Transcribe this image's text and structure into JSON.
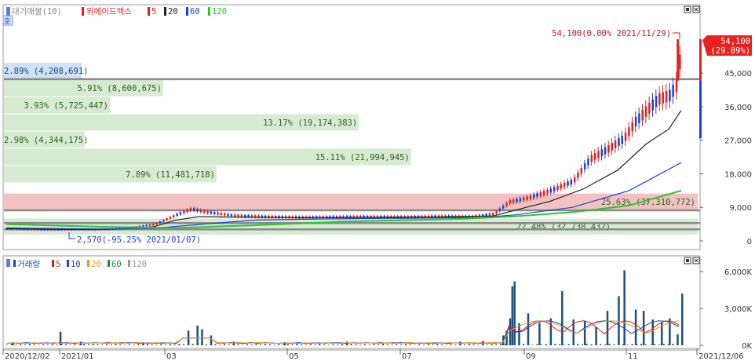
{
  "price_legend": {
    "dots_label": "대기매물(10)",
    "name": "위메이드맥스",
    "ma": [
      {
        "period": "5",
        "color": "#e02020"
      },
      {
        "period": "20",
        "color": "#222222"
      },
      {
        "period": "60",
        "color": "#1f3fd8"
      },
      {
        "period": "120",
        "color": "#2ec52e"
      }
    ]
  },
  "side_button": "호",
  "volume_legend": {
    "name": "거래량",
    "ma": [
      {
        "period": "5",
        "color": "#e02020"
      },
      {
        "period": "10",
        "color": "#1f3fd8"
      },
      {
        "period": "20",
        "color": "#e89a20"
      },
      {
        "period": "60",
        "color": "#1a8a4a"
      },
      {
        "period": "120",
        "color": "#999999"
      }
    ]
  },
  "chart_data": [
    {
      "type": "candlestick",
      "title": "위메이드맥스",
      "ylim": [
        0,
        54100
      ],
      "y_ticks": [
        "45,000",
        "36,000",
        "27,000",
        "18,000",
        "9,000",
        "0"
      ],
      "y_tick_values": [
        45000,
        36000,
        27000,
        18000,
        9000,
        0
      ],
      "x_tick_labels": [
        "2020/12/02",
        "2021/01",
        "03",
        "05",
        "07",
        "09",
        "11",
        "2021/12/06"
      ],
      "last_price": {
        "value": 54100,
        "label": "54,100",
        "change": "(29.89%)"
      },
      "high_annotation": {
        "text": "54,100(0.00% 2021/11/29)",
        "value": 54100,
        "date": "2021/11/29"
      },
      "low_annotation": {
        "text": "2,570(-95.25% 2021/01/07)",
        "value": 2570,
        "date": "2021/01/07"
      },
      "supply_bars": [
        {
          "label": "2.89% (4,208,691)",
          "price_from": 47800,
          "price_to": 43500,
          "pct": 2.89
        },
        {
          "label": "5.91% (8,600,675)",
          "price_from": 43200,
          "price_to": 38800,
          "pct": 5.91
        },
        {
          "label": "3.93% (5,725,447)",
          "price_from": 38600,
          "price_to": 34200,
          "pct": 3.93
        },
        {
          "label": "13.17% (19,174,383)",
          "price_from": 34000,
          "price_to": 29600,
          "pct": 13.17
        },
        {
          "label": "2.98% (4,344,175)",
          "price_from": 29400,
          "price_to": 25000,
          "pct": 2.98
        },
        {
          "label": "15.11% (21,994,945)",
          "price_from": 24800,
          "price_to": 20300,
          "pct": 15.11
        },
        {
          "label": "7.89% (11,481,718)",
          "price_from": 20100,
          "price_to": 15700,
          "pct": 7.89
        },
        {
          "label": "25.63% (37,310,772)",
          "price_from": 12700,
          "price_to": 8300,
          "pct": 25.63,
          "highlight": true
        },
        {
          "label": "22.48% (32,730,432)",
          "price_from": 6000,
          "price_to": 1700,
          "pct": 22.48
        }
      ],
      "series": [
        {
          "name": "5",
          "values": [
            [
              0,
              3200
            ],
            [
              20,
              3000
            ],
            [
              40,
              2900
            ],
            [
              60,
              3000
            ],
            [
              90,
              3100
            ],
            [
              110,
              3600
            ],
            [
              130,
              4400
            ],
            [
              150,
              7000
            ],
            [
              163,
              8600
            ],
            [
              175,
              7800
            ],
            [
              200,
              6800
            ],
            [
              230,
              6500
            ],
            [
              260,
              6300
            ],
            [
              290,
              6400
            ],
            [
              320,
              6500
            ],
            [
              350,
              6400
            ],
            [
              380,
              6600
            ],
            [
              410,
              6500
            ],
            [
              430,
              7200
            ],
            [
              444,
              10500
            ],
            [
              460,
              11500
            ],
            [
              480,
              13500
            ],
            [
              500,
              16000
            ],
            [
              515,
              22000
            ],
            [
              530,
              24500
            ],
            [
              545,
              27500
            ],
            [
              555,
              32000
            ],
            [
              565,
              35000
            ],
            [
              575,
              38000
            ],
            [
              585,
              39000
            ],
            [
              592,
              42000
            ],
            [
              596,
              54100
            ]
          ]
        },
        {
          "name": "20",
          "values": [
            [
              0,
              3300
            ],
            [
              40,
              3100
            ],
            [
              80,
              3000
            ],
            [
              110,
              3300
            ],
            [
              130,
              3800
            ],
            [
              150,
              5600
            ],
            [
              170,
              6500
            ],
            [
              200,
              6400
            ],
            [
              260,
              6200
            ],
            [
              320,
              6300
            ],
            [
              380,
              6400
            ],
            [
              430,
              6700
            ],
            [
              450,
              8300
            ],
            [
              480,
              10600
            ],
            [
              510,
              14000
            ],
            [
              540,
              19000
            ],
            [
              565,
              26000
            ],
            [
              585,
              30000
            ],
            [
              596,
              35000
            ]
          ]
        },
        {
          "name": "60",
          "values": [
            [
              0,
              3500
            ],
            [
              80,
              3200
            ],
            [
              130,
              3400
            ],
            [
              170,
              4400
            ],
            [
              220,
              5600
            ],
            [
              280,
              5900
            ],
            [
              350,
              6100
            ],
            [
              420,
              6300
            ],
            [
              450,
              7000
            ],
            [
              500,
              9000
            ],
            [
              550,
              13500
            ],
            [
              596,
              21000
            ]
          ]
        },
        {
          "name": "120",
          "values": [
            [
              0,
              4500
            ],
            [
              80,
              3800
            ],
            [
              150,
              3500
            ],
            [
              220,
              4200
            ],
            [
              300,
              5200
            ],
            [
              400,
              5900
            ],
            [
              450,
              6600
            ],
            [
              500,
              7700
            ],
            [
              550,
              9500
            ],
            [
              596,
              13500
            ]
          ]
        }
      ]
    },
    {
      "type": "bar",
      "title": "거래량",
      "ylim": [
        0,
        6000
      ],
      "unit": "K",
      "y_ticks": [
        "6,000K",
        "3,000K",
        "0K"
      ],
      "y_tick_values": [
        6000,
        3000,
        0
      ],
      "volume_spikes": [
        [
          5,
          250
        ],
        [
          47,
          1100
        ],
        [
          65,
          300
        ],
        [
          120,
          250
        ],
        [
          160,
          1200
        ],
        [
          168,
          1600
        ],
        [
          172,
          1300
        ],
        [
          180,
          800
        ],
        [
          200,
          300
        ],
        [
          245,
          250
        ],
        [
          300,
          300
        ],
        [
          400,
          300
        ],
        [
          420,
          350
        ],
        [
          438,
          800
        ],
        [
          441,
          1200
        ],
        [
          444,
          2200
        ],
        [
          446,
          4800
        ],
        [
          448,
          5200
        ],
        [
          452,
          1800
        ],
        [
          460,
          2600
        ],
        [
          470,
          1800
        ],
        [
          480,
          2200
        ],
        [
          490,
          4400
        ],
        [
          500,
          2100
        ],
        [
          510,
          2000
        ],
        [
          520,
          1500
        ],
        [
          530,
          2800
        ],
        [
          540,
          4000
        ],
        [
          545,
          6100
        ],
        [
          555,
          2900
        ],
        [
          562,
          2800
        ],
        [
          570,
          2100
        ],
        [
          578,
          1900
        ],
        [
          585,
          2200
        ],
        [
          592,
          900
        ],
        [
          596,
          4200
        ]
      ]
    }
  ]
}
